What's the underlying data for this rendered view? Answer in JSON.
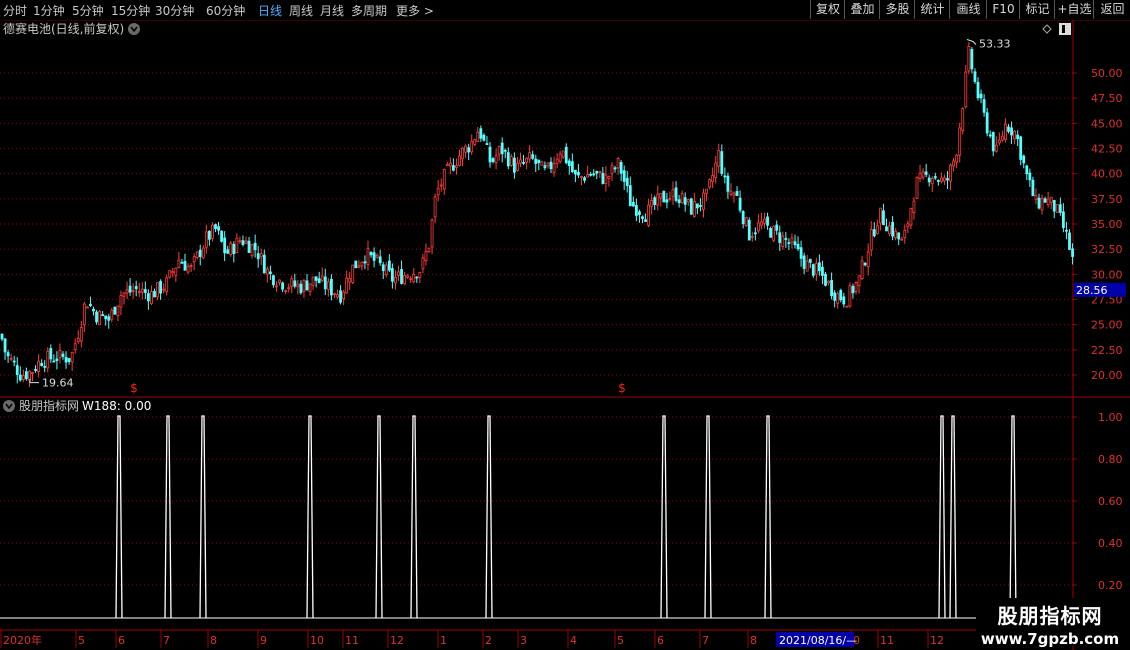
{
  "toolbar": {
    "periods": [
      "分时",
      "1分钟",
      "5分钟",
      "15分钟",
      "30分钟",
      "60分钟",
      "日线",
      "周线",
      "月线",
      "多周期",
      "更多 >"
    ],
    "active_period": "日线",
    "buttons": [
      "复权",
      "叠加",
      "多股",
      "统计",
      "画线",
      "F10",
      "标记",
      "+自选",
      "返回"
    ]
  },
  "main_panel": {
    "title": "德赛电池(日线,前复权)",
    "price_axis_labels": [
      "50.00",
      "47.50",
      "45.00",
      "42.50",
      "40.00",
      "37.50",
      "35.00",
      "32.50",
      "30.00",
      "27.50",
      "25.00",
      "22.50",
      "20.00"
    ],
    "current_price": "28.56",
    "high_marker": "53.33",
    "low_marker": "19.64",
    "signal_marker": "$"
  },
  "indicator_panel": {
    "title": "股朋指标网",
    "readout": "W188: 0.00",
    "axis_labels": [
      "1.00",
      "0.80",
      "0.60",
      "0.40",
      "0.20"
    ]
  },
  "time_axis": {
    "labels": [
      "2020年",
      "5",
      "6",
      "7",
      "8",
      "9",
      "10",
      "11",
      "12",
      "1",
      "2",
      "3",
      "4",
      "5",
      "6",
      "7",
      "8",
      "0",
      "11",
      "12"
    ],
    "cursor_date": "2021/08/16/—"
  },
  "watermark": {
    "title": "股朋指标网",
    "url": "www.7gpzb.com"
  },
  "colors": {
    "up_candle": "#ff3c3c",
    "down_candle": "#54ffff",
    "grid": "#a00000",
    "axis_text": "#e03030",
    "indicator_line": "#ffffff",
    "cursor_box": "#0000a8",
    "active_period": "#4fb0ff"
  },
  "chart_data": {
    "type": "candlestick",
    "title": "德赛电池(日线,前复权)",
    "price_range": [
      18.5,
      54.5
    ],
    "close_path": [
      [
        0,
        24.0
      ],
      [
        5,
        22.0
      ],
      [
        12,
        21.2
      ],
      [
        20,
        20.0
      ],
      [
        30,
        20.3
      ],
      [
        40,
        21.5
      ],
      [
        55,
        21.8
      ],
      [
        70,
        21.7
      ],
      [
        78,
        24.5
      ],
      [
        85,
        27.5
      ],
      [
        95,
        26.0
      ],
      [
        108,
        25.5
      ],
      [
        120,
        28.0
      ],
      [
        135,
        28.5
      ],
      [
        150,
        28.0
      ],
      [
        165,
        29.0
      ],
      [
        178,
        31.5
      ],
      [
        190,
        30.5
      ],
      [
        205,
        33.5
      ],
      [
        215,
        34.5
      ],
      [
        225,
        32.0
      ],
      [
        240,
        33.5
      ],
      [
        255,
        32.5
      ],
      [
        268,
        30.0
      ],
      [
        285,
        29.0
      ],
      [
        300,
        28.8
      ],
      [
        315,
        29.5
      ],
      [
        330,
        28.5
      ],
      [
        340,
        28.0
      ],
      [
        350,
        30.5
      ],
      [
        365,
        32.0
      ],
      [
        378,
        31.0
      ],
      [
        392,
        29.5
      ],
      [
        405,
        30.0
      ],
      [
        420,
        30.5
      ],
      [
        428,
        33.0
      ],
      [
        435,
        38.0
      ],
      [
        445,
        40.0
      ],
      [
        460,
        42.0
      ],
      [
        470,
        43.0
      ],
      [
        478,
        44.5
      ],
      [
        490,
        41.0
      ],
      [
        500,
        42.5
      ],
      [
        515,
        40.5
      ],
      [
        530,
        41.5
      ],
      [
        545,
        40.0
      ],
      [
        560,
        42.5
      ],
      [
        575,
        39.5
      ],
      [
        590,
        40.0
      ],
      [
        605,
        39.5
      ],
      [
        618,
        41.0
      ],
      [
        630,
        37.0
      ],
      [
        645,
        36.0
      ],
      [
        660,
        37.5
      ],
      [
        675,
        38.0
      ],
      [
        690,
        36.5
      ],
      [
        705,
        37.5
      ],
      [
        718,
        42.0
      ],
      [
        725,
        38.5
      ],
      [
        735,
        38.0
      ],
      [
        748,
        34.0
      ],
      [
        760,
        35.0
      ],
      [
        775,
        34.0
      ],
      [
        790,
        33.0
      ],
      [
        805,
        31.0
      ],
      [
        820,
        30.0
      ],
      [
        835,
        28.0
      ],
      [
        845,
        27.5
      ],
      [
        858,
        29.5
      ],
      [
        868,
        33.0
      ],
      [
        878,
        36.0
      ],
      [
        890,
        34.5
      ],
      [
        902,
        33.0
      ],
      [
        915,
        39.0
      ],
      [
        930,
        40.0
      ],
      [
        945,
        39.0
      ],
      [
        955,
        42.0
      ],
      [
        963,
        48.0
      ],
      [
        968,
        52.0
      ],
      [
        975,
        48.5
      ],
      [
        985,
        45.0
      ],
      [
        995,
        42.0
      ],
      [
        1005,
        45.0
      ],
      [
        1015,
        44.0
      ],
      [
        1025,
        40.0
      ],
      [
        1035,
        37.0
      ],
      [
        1045,
        37.5
      ],
      [
        1055,
        36.5
      ],
      [
        1065,
        34.0
      ],
      [
        1074,
        30.5
      ]
    ],
    "high": 53.33,
    "low": 19.64,
    "last": 28.56,
    "y_ticks": [
      50.0,
      47.5,
      45.0,
      42.5,
      40.0,
      37.5,
      35.0,
      32.5,
      30.0,
      27.5,
      25.0,
      22.5,
      20.0
    ],
    "indicator": {
      "name": "W188",
      "value": 0.0,
      "y_ticks": [
        1.0,
        0.8,
        0.6,
        0.4,
        0.2
      ],
      "spikes_x_px_note": "",
      "spike_count": 14
    }
  }
}
